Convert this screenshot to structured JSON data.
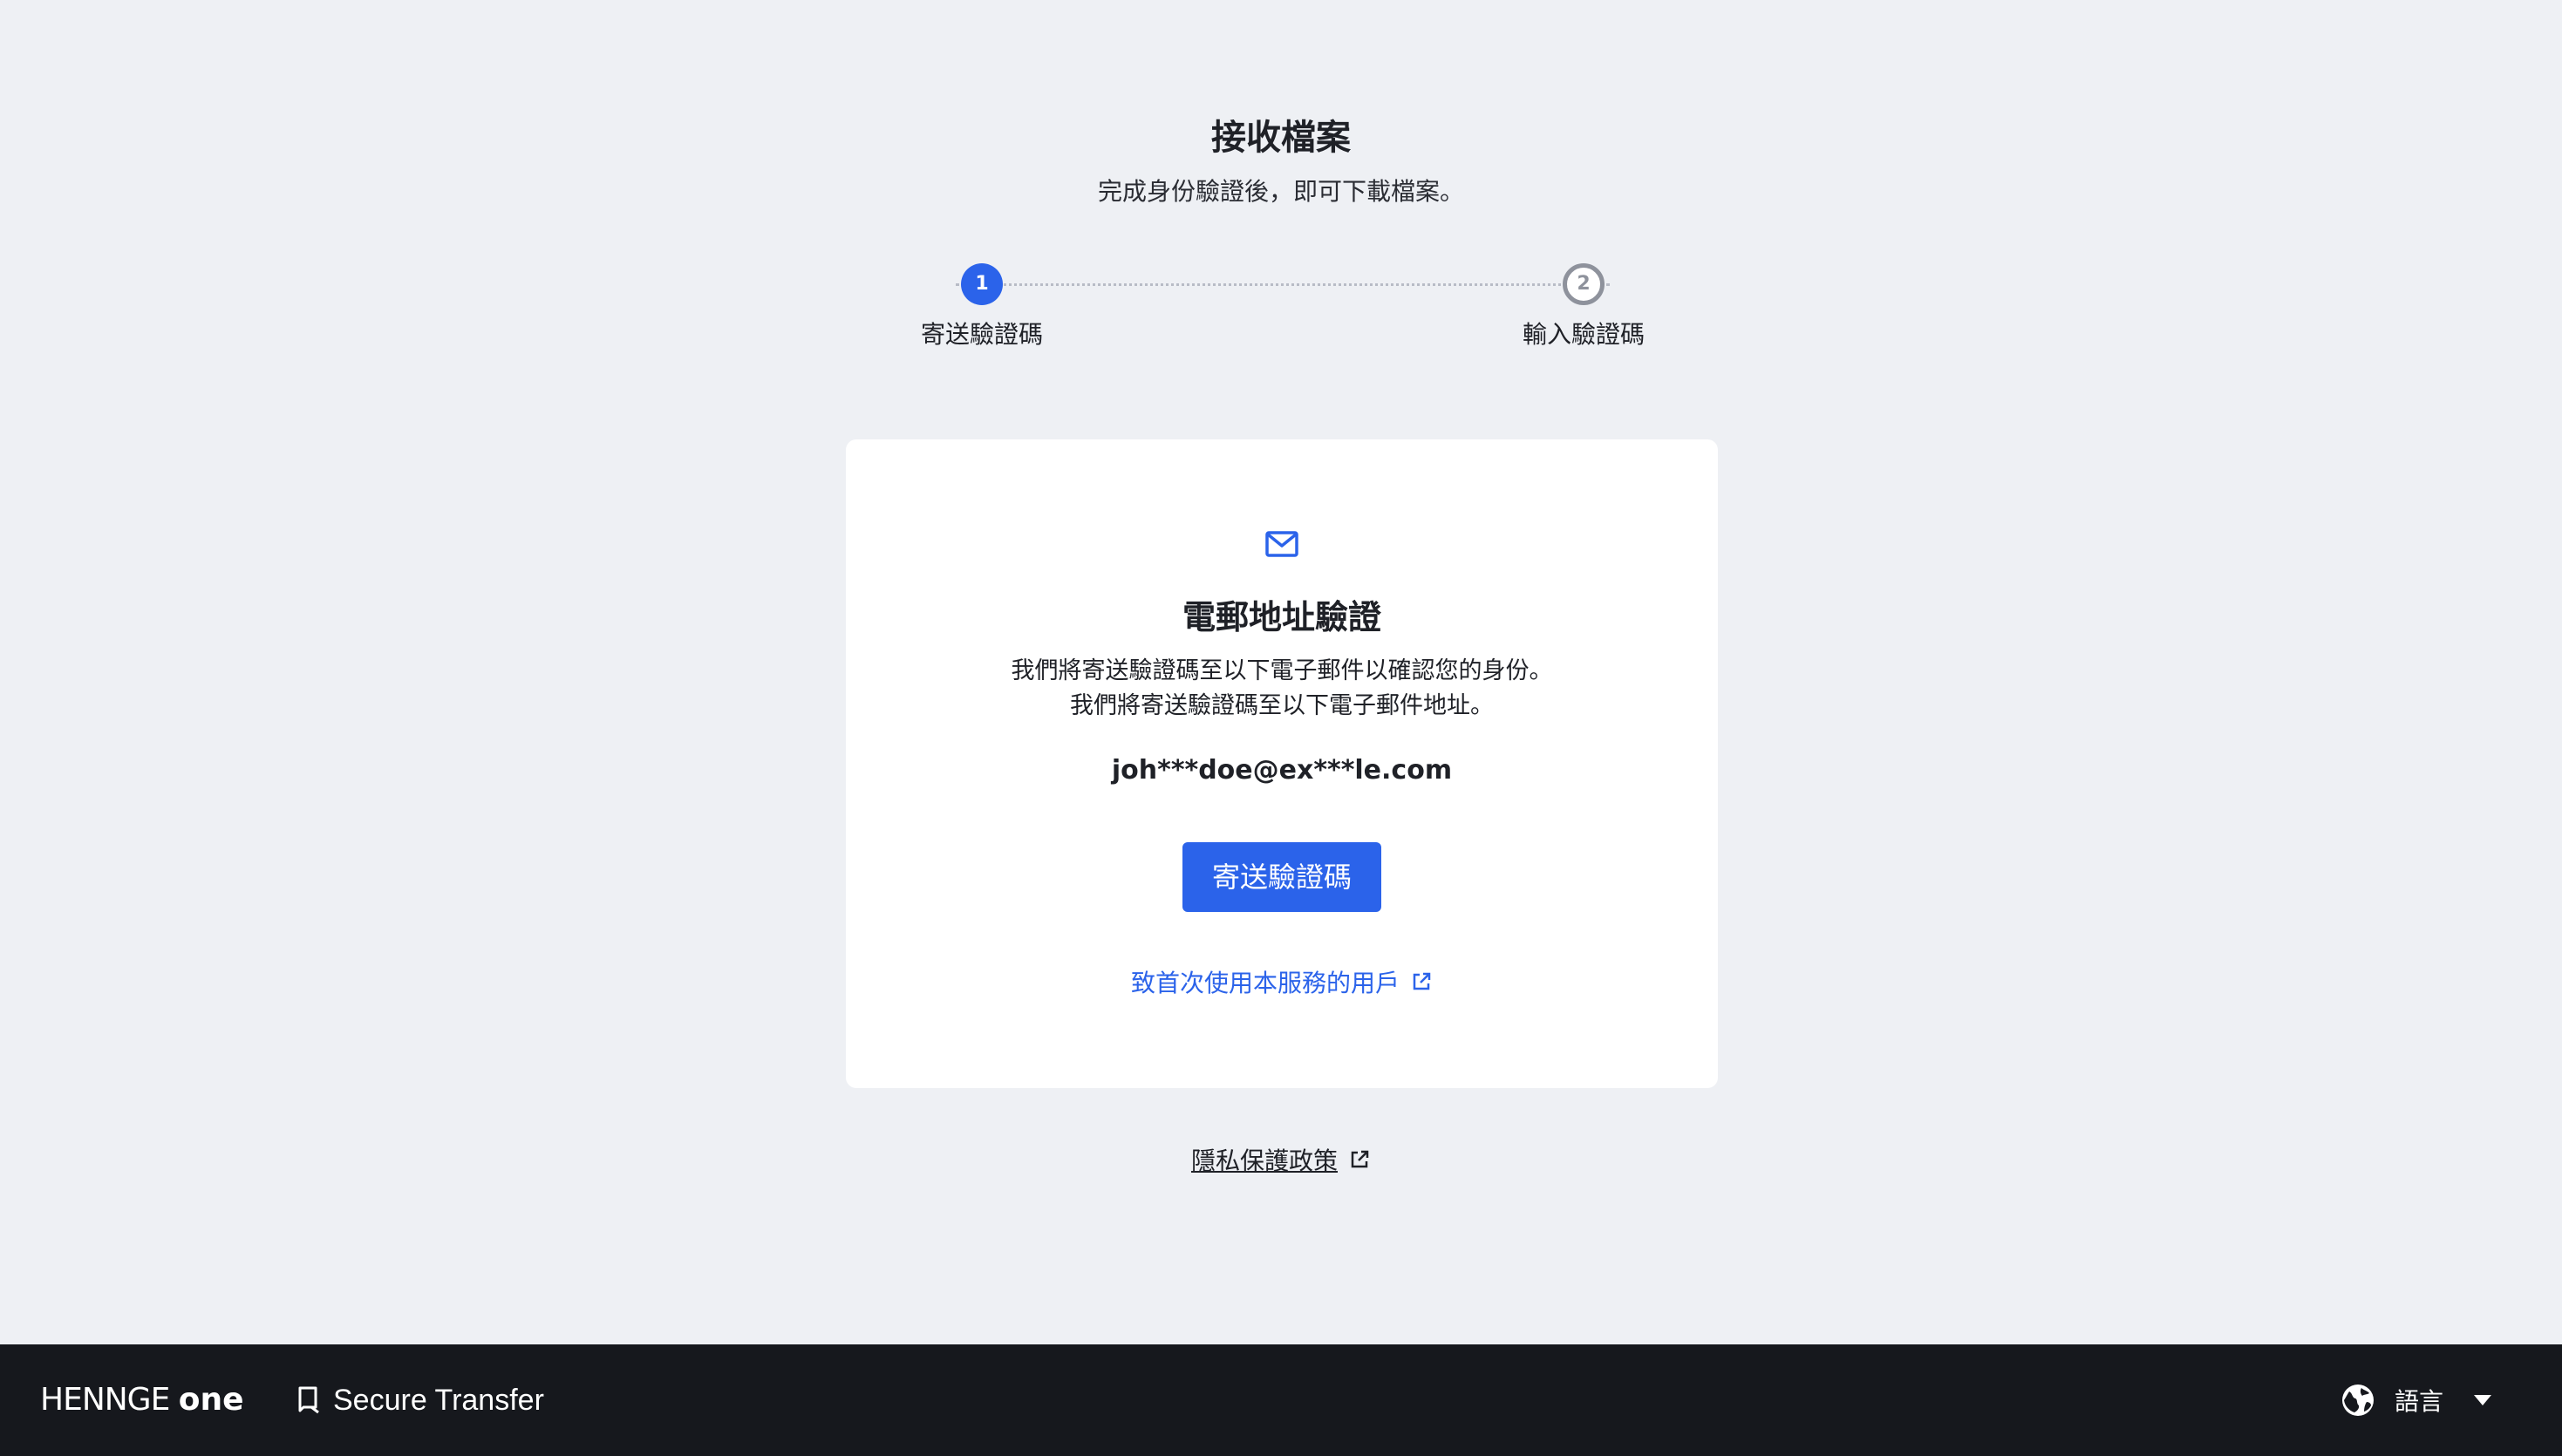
{
  "header": {
    "title": "接收檔案",
    "subtitle": "完成身份驗證後，即可下載檔案。"
  },
  "stepper": {
    "steps": [
      {
        "number": "1",
        "label": "寄送驗證碼",
        "state": "active"
      },
      {
        "number": "2",
        "label": "輸入驗證碼",
        "state": "inactive"
      }
    ]
  },
  "card": {
    "icon": "mail-icon",
    "title": "電郵地址驗證",
    "description_line1": "我們將寄送驗證碼至以下電子郵件以確認您的身份。",
    "description_line2": "我們將寄送驗證碼至以下電子郵件地址。",
    "email": "joh***doe@ex***le.com",
    "send_button_label": "寄送驗證碼",
    "first_time_link": "致首次使用本服務的用戶"
  },
  "privacy_link": "隱私保護政策",
  "footer": {
    "logo_brand": "HENNGE",
    "logo_one": "one",
    "product_name": "Secure Transfer",
    "language_label": "語言"
  },
  "colors": {
    "accent": "#2b63ea",
    "background": "#eef0f4",
    "footer_bg": "#16181d",
    "inactive_step": "#8e929c"
  }
}
